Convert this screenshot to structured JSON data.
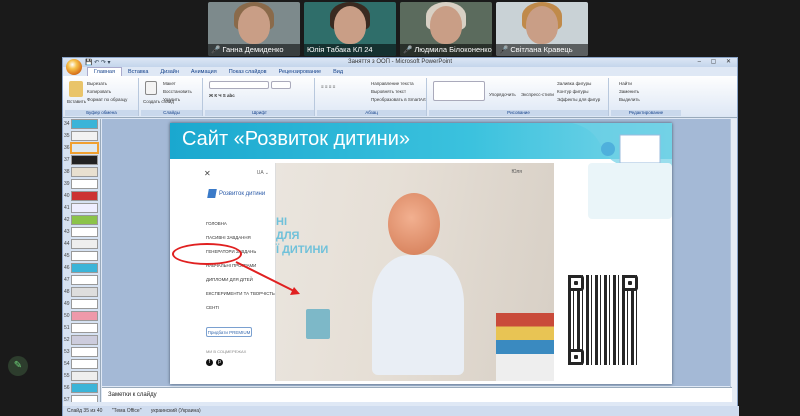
{
  "participants": [
    {
      "name": "Ганна Демиденко",
      "bg": "#7d8a8c",
      "hair": "#8a6a4a"
    },
    {
      "name": "Юлія Табака КЛ 24",
      "bg": "#2f6e6a",
      "hair": "#3a2a20"
    },
    {
      "name": "Людмила Білоконенко",
      "bg": "#5b6b5d",
      "hair": "#d8d0c4"
    },
    {
      "name": "Світлана Кравець",
      "bg": "#c9d2d6",
      "hair": "#c08a4a"
    }
  ],
  "powerpoint": {
    "window_title": "Заняття з ООП - Microsoft PowerPoint",
    "tabs": [
      "Главная",
      "Вставка",
      "Дизайн",
      "Анимация",
      "Показ слайдов",
      "Рецензирование",
      "Вид"
    ],
    "active_tab": "Главная",
    "ribbon_groups": [
      {
        "label": "Буфер обмена",
        "items": [
          "Вставить",
          "Вырезать",
          "Копировать",
          "Формат по образцу"
        ]
      },
      {
        "label": "Слайды",
        "items": [
          "Создать слайд",
          "Макет",
          "Восстановить",
          "Удалить"
        ]
      },
      {
        "label": "Шрифт",
        "items": []
      },
      {
        "label": "Абзац",
        "items": [
          "Направление текста",
          "Выровнять текст",
          "Преобразовать в SmartArt"
        ]
      },
      {
        "label": "Рисование",
        "items": [
          "Упорядочить",
          "Экспресс-стили",
          "Заливка фигуры",
          "Контур фигуры",
          "Эффекты для фигур"
        ]
      },
      {
        "label": "Редактирование",
        "items": [
          "Найти",
          "Заменить",
          "Выделить"
        ]
      }
    ],
    "slide_numbers": [
      "34",
      "35",
      "36",
      "37",
      "38",
      "39",
      "40",
      "41",
      "42",
      "43",
      "44",
      "45",
      "46",
      "47",
      "48",
      "49",
      "50",
      "51",
      "52",
      "53",
      "54",
      "55",
      "56",
      "57"
    ],
    "active_slide_index": 2,
    "notes_placeholder": "Заметки к слайду",
    "status": {
      "slide_info": "Слайд 35 из 40",
      "theme": "\"Тема Office\"",
      "language": "украинский (Украина)"
    }
  },
  "slide": {
    "title": "Сайт «Розвиток дитини»",
    "site": {
      "close_glyph": "✕",
      "lang": "UA ⌄",
      "logo": "Розвиток дитини",
      "user": "Юля",
      "menu_items": [
        "ГОЛОВНА",
        "ПАСИВНІ ЗАВДАННЯ",
        "ГЕНЕРАТОРИ ЗАВДАНЬ",
        "НАВЧАЛЬНІ ПРОГРАМИ",
        "ДИПЛОМИ ДЛЯ ДІТЕЙ",
        "ЕКСПЕРИМЕНТИ ТА ТВОРЧІСТЬ",
        "СЕНТІ"
      ],
      "premium": "Придбати PREMIUM",
      "social_label": "МИ В СОЦМЕРЕЖАХ",
      "hero_lines": [
        "НІ",
        "ДЛЯ",
        "Ї ДИТИНИ"
      ]
    },
    "highlighted_item": "ГЕНЕРАТОРИ ЗАВДАНЬ",
    "annotation_color": "#e02020"
  }
}
